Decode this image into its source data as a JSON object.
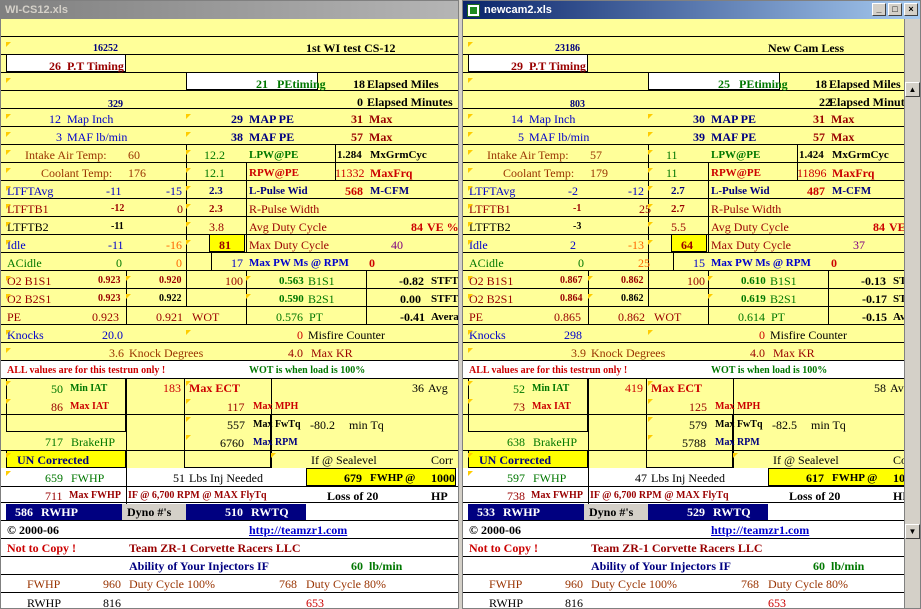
{
  "left": {
    "title": "WI-CS12.xls",
    "top_num": "16252",
    "heading": "1st WI test CS-12",
    "pt_val": "26",
    "pt_label": "P.T Timing",
    "petiming_val": "21",
    "petiming_label": "PEtiming",
    "elapsed_miles_val": "18",
    "elapsed_miles_label": "Elapsed Miles",
    "small_num": "329",
    "elapsed_min_val": "0",
    "elapsed_min_label": "Elapsed Minutes",
    "map_inch": "12",
    "map_inch_label": "Map Inch",
    "map_pe": "29",
    "map_pe_label": "MAP PE",
    "map_max": "31",
    "map_max_label": "Max",
    "maf": "3",
    "maf_label": "MAF lb/min",
    "maf_pe": "38",
    "maf_pe_label": "MAF PE",
    "maf_max": "57",
    "maf_max_label": "Max",
    "iat_label": "Intake Air Temp:",
    "iat": "60",
    "lpw_pe_val": "12.2",
    "lpw_pe_label": "LPW@PE",
    "mxgrm_val": "1.284",
    "mxgrm_label": "MxGrmCyc",
    "cool_label": "Coolant Temp:",
    "cool": "176",
    "rpw_pe_val": "12.1",
    "rpw_pe_label": "RPW@PE",
    "maxfrq_val": "11332",
    "maxfrq_label": "MaxFrq",
    "ltftavg_label": "LTFTAvg",
    "ltftavg_a": "-11",
    "ltftavg_b": "-15",
    "lpulse_val": "2.3",
    "lpulse_label": "L-Pulse Wid",
    "mcfm_val": "568",
    "mcfm_label": "M-CFM",
    "ltftb1_label": "LTFTB1",
    "ltftb1_a": "-12",
    "ltftb1_b": "0",
    "rpulse_val": "2.3",
    "rpulse_label": "R-Pulse Width",
    "ltftb2_label": "LTFTB2",
    "ltftb2_a": "-11",
    "avgduty_val": "3.8",
    "avgduty_label": "Avg Duty Cycle",
    "ve_val": "84",
    "ve_label": "VE %",
    "idle_label": "Idle",
    "idle_a": "-11",
    "idle_b": "-16",
    "maxduty_box": "81",
    "maxduty_label": "Max Duty Cycle",
    "maxduty_val": "40",
    "acidle_label": "ACidle",
    "acidle_a": "0",
    "acidle_b": "0",
    "maxpw_val": "17",
    "maxpw_label": "Max PW Ms @ RPM",
    "maxpw_rpm": "0",
    "o2b1s1_label": "O2 B1S1",
    "o2b1s1_a": "0.923",
    "o2b1s1_b": "0.920",
    "o2b1s1_c": "100",
    "b1s1_val": "0.563",
    "b1s1_label": "B1S1",
    "stft1_val": "-0.82",
    "stft1_label": "STFT",
    "o2b2s1_label": "O2 B2S1",
    "o2b2s1_a": "0.923",
    "o2b2s1_b": "0.922",
    "b2s1_val": "0.590",
    "b2s1_label": "B2S1",
    "stft2_val": "0.00",
    "stft2_label": "STFT",
    "pe_label": "PE",
    "pe_a": "0.923",
    "pe_b": "0.921",
    "wot_label": "WOT",
    "pt_row_val": "0.576",
    "pt_row_label": "PT",
    "avg_val": "-0.41",
    "avg_label": "Avera",
    "knocks_label": "Knocks",
    "knocks_val": "20.0",
    "misfire_val": "0",
    "misfire_label": "Misfire Counter",
    "knockdeg_val": "3.6",
    "knockdeg_label": "Knock  Degrees",
    "maxkr_val": "4.0",
    "maxkr_label": "Max KR",
    "all_values": "ALL values are for this testrun only !",
    "wot_note": "WOT is when load is 100%",
    "min_iat_val": "50",
    "min_iat_label": "Min IAT",
    "max_ect_val": "183",
    "max_ect_label": "Max ECT",
    "avg2_val": "36",
    "avg2_label": "Avg",
    "max_iat_val": "86",
    "max_iat_label": "Max IAT",
    "max_mph_val": "117",
    "max_mph_label": "Max MPH",
    "max_fwtq_val": "557",
    "max_fwtq_label": "Max FwTq",
    "min_tq_val": "-80.2",
    "min_tq_label": "min Tq",
    "max_rpm_val": "6760",
    "max_rpm_label": "Max RPM",
    "brakehp_val": "717",
    "brakehp_label": "BrakeHP",
    "uncorrected": "UN Corrected",
    "if_sealevel": "If @ Sealevel",
    "corr": "Corr",
    "fwhp_val": "659",
    "fwhp_label": "FWHP",
    "lbs_val": "51",
    "lbs_label": "Lbs Inj Needed",
    "fwhp_box_val": "679",
    "fwhp_box_label": "FWHP  @",
    "fwhp_box_1000": "1000",
    "maxfwhp_val": "711",
    "maxfwhp_label": "Max FWHP",
    "if6700": "IF @ 6,700 RPM @ MAX FlyTq",
    "loss_label": "Loss of 20",
    "hp_label": "HP",
    "rwhp_val": "586",
    "rwhp_label": "RWHP",
    "dyno_label": "Dyno #'s",
    "rwtq_val": "510",
    "rwtq_label": "RWTQ",
    "copyright": "© 2000-06",
    "url": "http://teamzr1.com",
    "notcopy": "Not to Copy !",
    "team": "Team ZR-1 Corvette Racers LLC",
    "ability": "Ability of Your Injectors IF",
    "lbmin_val": "60",
    "lbmin_label": "lb/min",
    "fwhp2_label": "FWHP",
    "duty100_val": "960",
    "duty100_label": "Duty Cycle 100%",
    "duty80_val": "768",
    "duty80_label": "Duty Cycle 80%",
    "rwhp2_label": "RWHP",
    "rwhp2_val": "816",
    "rwhp2_val2": "653"
  },
  "right": {
    "title": "newcam2.xls",
    "top_num": "23186",
    "heading": "New Cam Less",
    "pt_val": "29",
    "pt_label": "P.T Timing",
    "petiming_val": "25",
    "petiming_label": "PEtiming",
    "elapsed_miles_val": "18",
    "elapsed_miles_label": "Elapsed Miles",
    "small_num": "803",
    "elapsed_min_val": "22",
    "elapsed_min_label": "Elapsed Minute",
    "map_inch": "14",
    "map_inch_label": "Map Inch",
    "map_pe": "30",
    "map_pe_label": "MAP PE",
    "map_max": "31",
    "map_max_label": "Max",
    "maf": "5",
    "maf_label": "MAF lb/min",
    "maf_pe": "39",
    "maf_pe_label": "MAF PE",
    "maf_max": "57",
    "maf_max_label": "Max",
    "iat_label": "Intake Air Temp:",
    "iat": "57",
    "lpw_pe_val": "11",
    "lpw_pe_label": "LPW@PE",
    "mxgrm_val": "1.424",
    "mxgrm_label": "MxGrmCyc",
    "cool_label": "Coolant Temp:",
    "cool": "179",
    "rpw_pe_val": "11",
    "rpw_pe_label": "RPW@PE",
    "maxfrq_val": "11896",
    "maxfrq_label": "MaxFrq",
    "ltftavg_label": "LTFTAvg",
    "ltftavg_a": "-2",
    "ltftavg_b": "-12",
    "lpulse_val": "2.7",
    "lpulse_label": "L-Pulse Wid",
    "mcfm_val": "487",
    "mcfm_label": "M-CFM",
    "ltftb1_label": "LTFTB1",
    "ltftb1_a": "-1",
    "ltftb1_b": "25",
    "rpulse_val": "2.7",
    "rpulse_label": "R-Pulse Width",
    "ltftb2_label": "LTFTB2",
    "ltftb2_a": "-3",
    "avgduty_val": "5.5",
    "avgduty_label": "Avg Duty Cycle",
    "ve_val": "84",
    "ve_label": "VE %",
    "idle_label": "Idle",
    "idle_a": "2",
    "idle_b": "-13",
    "maxduty_box": "64",
    "maxduty_label": "Max Duty Cycle",
    "maxduty_val": "37",
    "acidle_label": "ACidle",
    "acidle_a": "0",
    "acidle_b": "25",
    "maxpw_val": "15",
    "maxpw_label": "Max PW Ms @ RPM",
    "maxpw_rpm": "0",
    "o2b1s1_label": "O2 B1S1",
    "o2b1s1_a": "0.867",
    "o2b1s1_b": "0.862",
    "o2b1s1_c": "100",
    "b1s1_val": "0.610",
    "b1s1_label": "B1S1",
    "stft1_val": "-0.13",
    "stft1_label": "STFT",
    "o2b2s1_label": "O2 B2S1",
    "o2b2s1_a": "0.864",
    "o2b2s1_b": "0.862",
    "b2s1_val": "0.619",
    "b2s1_label": "B2S1",
    "stft2_val": "-0.17",
    "stft2_label": "STFT",
    "pe_label": "PE",
    "pe_a": "0.865",
    "pe_b": "0.862",
    "wot_label": "WOT",
    "pt_row_val": "0.614",
    "pt_row_label": "PT",
    "avg_val": "-0.15",
    "avg_label": "Avera",
    "knocks_label": "Knocks",
    "knocks_val": "298",
    "misfire_val": "0",
    "misfire_label": "Misfire Counter",
    "knockdeg_val": "3.9",
    "knockdeg_label": "Knock  Degrees",
    "maxkr_val": "4.0",
    "maxkr_label": "Max KR",
    "all_values": "ALL values are for this testrun only !",
    "wot_note": "WOT is when load is 100%",
    "min_iat_val": "52",
    "min_iat_label": "Min IAT",
    "max_ect_val": "419",
    "max_ect_label": "Max ECT",
    "avg2_val": "58",
    "avg2_label": "Avg",
    "max_iat_val": "73",
    "max_iat_label": "Max IAT",
    "max_mph_val": "125",
    "max_mph_label": "Max MPH",
    "max_fwtq_val": "579",
    "max_fwtq_label": "Max FwTq",
    "min_tq_val": "-82.5",
    "min_tq_label": "min Tq",
    "max_rpm_val": "5788",
    "max_rpm_label": "Max RPM",
    "brakehp_val": "638",
    "brakehp_label": "BrakeHP",
    "uncorrected": "UN Corrected",
    "if_sealevel": "If @ Sealevel",
    "corr": "Corr",
    "fwhp_val": "597",
    "fwhp_label": "FWHP",
    "lbs_val": "47",
    "lbs_label": "Lbs Inj Needed",
    "fwhp_box_val": "617",
    "fwhp_box_label": "FWHP  @",
    "fwhp_box_1000": "1000",
    "maxfwhp_val": "738",
    "maxfwhp_label": "Max FWHP",
    "if6700": "IF @ 6,700 RPM @ MAX FlyTq",
    "loss_label": "Loss of 20",
    "hp_label": "HP",
    "rwhp_val": "533",
    "rwhp_label": "RWHP",
    "dyno_label": "Dyno #'s",
    "rwtq_val": "529",
    "rwtq_label": "RWTQ",
    "copyright": "© 2000-06",
    "url": "http://teamzr1.com",
    "notcopy": "Not to Copy !",
    "team": "Team ZR-1 Corvette Racers LLC",
    "ability": "Ability of Your Injectors IF",
    "lbmin_val": "60",
    "lbmin_label": "lb/min",
    "fwhp2_label": "FWHP",
    "duty100_val": "960",
    "duty100_label": "Duty Cycle 100%",
    "duty80_val": "768",
    "duty80_label": "Duty Cycle 80%",
    "rwhp2_label": "RWHP",
    "rwhp2_val": "816",
    "rwhp2_val2": "653"
  },
  "colors": {
    "sheet_yellow": "#ffff99",
    "box_yellow": "#ffff00",
    "navy": "#000080",
    "titlebar_active": "#0a246a"
  },
  "icons": {
    "window_icon": "excel-sheet-icon",
    "minimize": "minimize-icon",
    "restore": "restore-icon",
    "close": "close-icon"
  },
  "controls": {
    "minimize": "_",
    "restore": "□",
    "close": "×",
    "scroll_up": "▲",
    "scroll_down": "▼"
  }
}
